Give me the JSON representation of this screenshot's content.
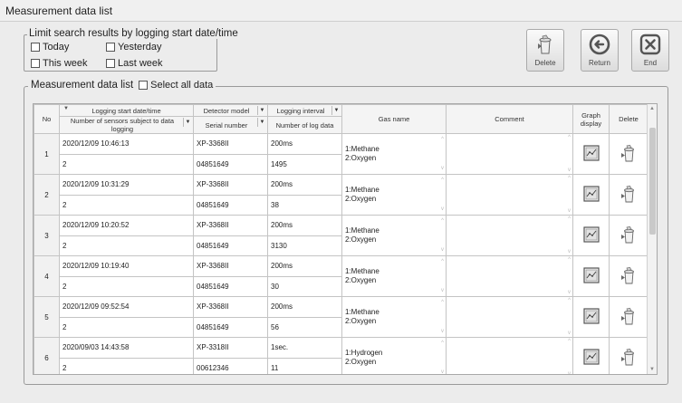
{
  "window": {
    "title": "Measurement data list"
  },
  "filter": {
    "legend": "Limit search results by logging start date/time",
    "options": [
      "Today",
      "Yesterday",
      "This week",
      "Last week"
    ]
  },
  "toolbar": {
    "delete_label": "Delete",
    "return_label": "Return",
    "end_label": "End"
  },
  "list": {
    "legend": "Measurement data list",
    "select_all_label": "Select all data",
    "headers": {
      "no": "No",
      "start": "Logging start date/time",
      "sensors": "Number of sensors subject to data logging",
      "model": "Detector model",
      "serial": "Serial number",
      "interval": "Logging interval",
      "log_count": "Number of log data",
      "gas": "Gas name",
      "comment": "Comment",
      "graph_1": "Graph",
      "graph_2": "display",
      "delete": "Delete"
    },
    "rows": [
      {
        "no": "1",
        "start": "2020/12/09 10:46:13",
        "sensors": "2",
        "model": "XP-3368II",
        "serial": "04851649",
        "interval": "200ms",
        "log_count": "1495",
        "gas1": "1:Methane",
        "gas2": "2:Oxygen"
      },
      {
        "no": "2",
        "start": "2020/12/09 10:31:29",
        "sensors": "2",
        "model": "XP-3368II",
        "serial": "04851649",
        "interval": "200ms",
        "log_count": "38",
        "gas1": "1:Methane",
        "gas2": "2:Oxygen"
      },
      {
        "no": "3",
        "start": "2020/12/09 10:20:52",
        "sensors": "2",
        "model": "XP-3368II",
        "serial": "04851649",
        "interval": "200ms",
        "log_count": "3130",
        "gas1": "1:Methane",
        "gas2": "2:Oxygen"
      },
      {
        "no": "4",
        "start": "2020/12/09 10:19:40",
        "sensors": "2",
        "model": "XP-3368II",
        "serial": "04851649",
        "interval": "200ms",
        "log_count": "30",
        "gas1": "1:Methane",
        "gas2": "2:Oxygen"
      },
      {
        "no": "5",
        "start": "2020/12/09 09:52:54",
        "sensors": "2",
        "model": "XP-3368II",
        "serial": "04851649",
        "interval": "200ms",
        "log_count": "56",
        "gas1": "1:Methane",
        "gas2": "2:Oxygen"
      },
      {
        "no": "6",
        "start": "2020/09/03 14:43:58",
        "sensors": "2",
        "model": "XP-3318II",
        "serial": "00612346",
        "interval": "1sec.",
        "log_count": "11",
        "gas1": "1:Hydrogen",
        "gas2": "2:Oxygen"
      }
    ]
  },
  "colors": {
    "background": "#ececec",
    "header": "#f4f4f4",
    "border": "#c4c4c4"
  },
  "icons": {
    "delete": "trash-bin-icon",
    "return": "return-arrow-icon",
    "end": "close-x-icon",
    "graph": "graph-display-icon"
  }
}
